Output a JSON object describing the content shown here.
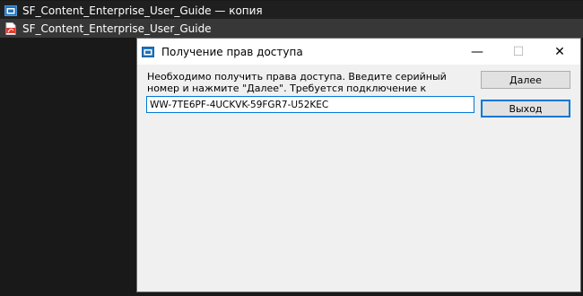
{
  "explorer": {
    "items": [
      {
        "label": "SF_Content_Enterprise_User_Guide — копия",
        "icon": "app-window-icon"
      },
      {
        "label": "SF_Content_Enterprise_User_Guide",
        "icon": "pdf-file-icon"
      }
    ]
  },
  "dialog": {
    "title": "Получение прав доступа",
    "icon": "app-window-icon",
    "minimize_glyph": "—",
    "maximize_glyph": "☐",
    "close_glyph": "✕",
    "message": "Необходимо получить права доступа. Введите серийный номер и нажмите \"Далее\". Требуется подключение к Интернет.",
    "serial_value": "WW-7TE6PF-4UCKVK-59FGR7-U52KEC",
    "next_label": "Далее",
    "exit_label": "Выход"
  },
  "colors": {
    "background": "#191919",
    "selected_row": "#373737",
    "dialog_bg": "#f0f0f0",
    "focus_blue": "#0078d7",
    "app_icon_blue": "#1e73be",
    "pdf_icon_red": "#e03c31"
  }
}
